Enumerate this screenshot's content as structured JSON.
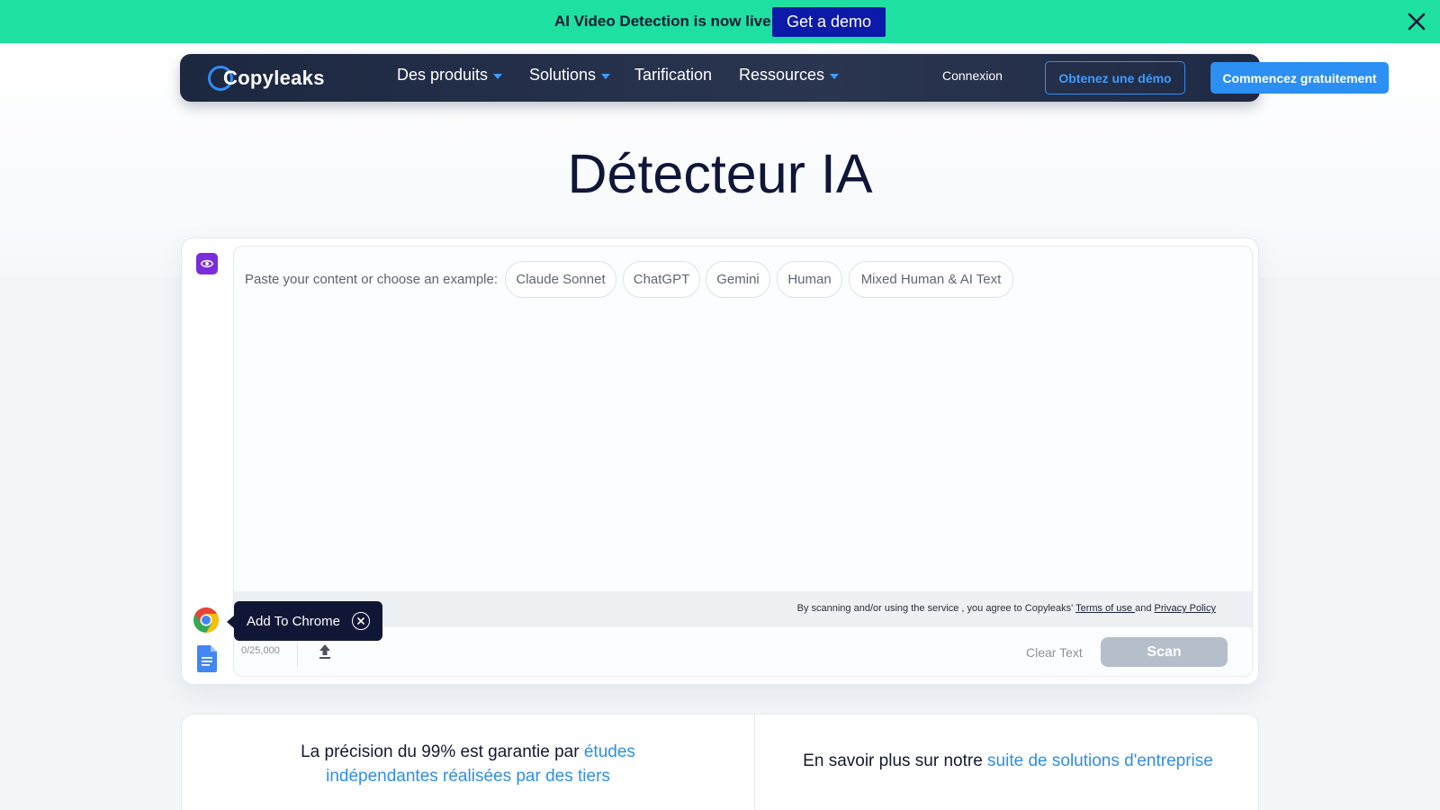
{
  "announcement": {
    "text": "AI Video Detection is now live",
    "button_label": "Get a demo",
    "close_icon": "close-icon",
    "background_color": "#1ee0a0"
  },
  "nav": {
    "logo_text": "Copyleaks",
    "items": [
      {
        "label": "Des produits",
        "has_dropdown": true
      },
      {
        "label": "Solutions",
        "has_dropdown": true
      },
      {
        "label": "Tarification",
        "has_dropdown": false
      },
      {
        "label": "Ressources",
        "has_dropdown": true
      }
    ],
    "login_label": "Connexion",
    "demo_label": "Obtenez une démo",
    "start_label": "Commencez gratuitement"
  },
  "page": {
    "title": "Détecteur IA"
  },
  "editor": {
    "prompt": "Paste your content or choose an example:",
    "examples": [
      "Claude Sonnet",
      "ChatGPT",
      "Gemini",
      "Human",
      "Mixed Human & AI Text"
    ],
    "terms_prefix": "By scanning and/or using the service , you agree to Copyleaks' ",
    "terms_link": "Terms of use ",
    "terms_and": "and ",
    "privacy_link": "Privacy Policy",
    "counter": "0/25,000",
    "clear_label": "Clear Text",
    "scan_label": "Scan"
  },
  "sidebar": {
    "eye_icon": "eye-icon",
    "chrome_icon": "chrome-icon",
    "doc_icon": "google-docs-icon",
    "tooltip_label": "Add To Chrome"
  },
  "info": {
    "left_prefix": "La précision du 99% est garantie par ",
    "left_link": "études indépendantes réalisées par des tiers",
    "right_prefix": "En savoir plus sur notre ",
    "right_link": "suite de solutions d'entreprise"
  }
}
